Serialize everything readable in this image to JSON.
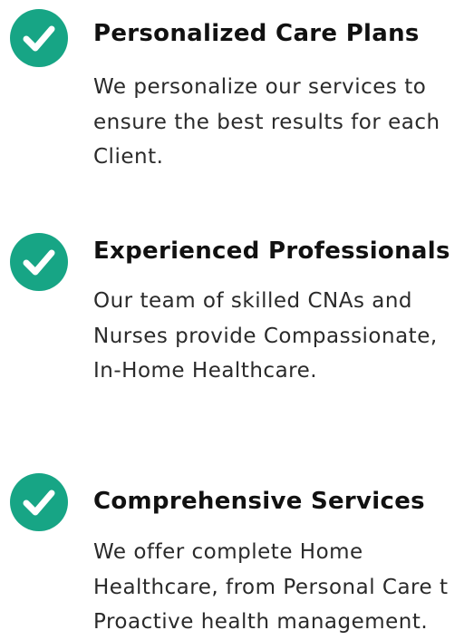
{
  "accent_color": "#17a585",
  "features": [
    {
      "icon": "check-circle-icon",
      "title": "Personalized Care Plans",
      "lines": [
        "We personalize our services to",
        "ensure the best results for each",
        "Client."
      ]
    },
    {
      "icon": "check-circle-icon",
      "title": "Experienced Professionals",
      "lines": [
        "Our team of skilled CNAs and",
        "Nurses provide Compassionate,",
        "In-Home Healthcare."
      ]
    },
    {
      "icon": "check-circle-icon",
      "title": "Comprehensive Services",
      "lines": [
        "We offer complete Home",
        "Healthcare, from Personal Care t",
        "Proactive health management."
      ]
    }
  ]
}
